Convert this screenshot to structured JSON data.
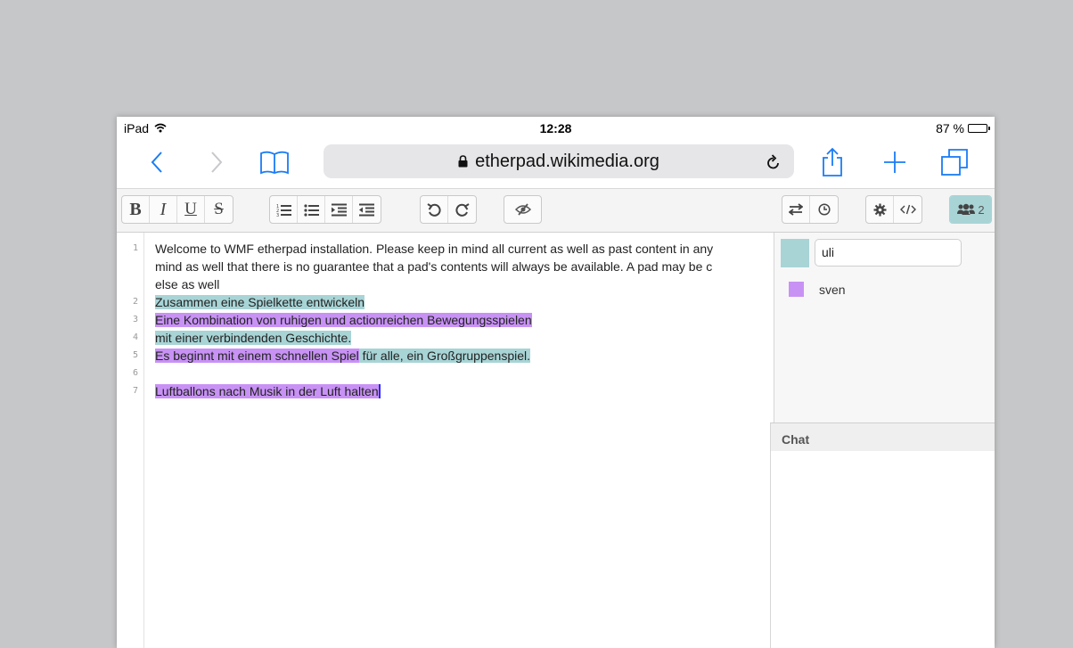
{
  "status": {
    "device": "iPad",
    "time": "12:28",
    "battery": "87 %",
    "battery_level": 0.87
  },
  "browser": {
    "url": "etherpad.wikimedia.org",
    "icons": [
      "back-icon",
      "forward-icon",
      "bookmarks-icon",
      "lock-icon",
      "reload-icon",
      "share-icon",
      "new-tab-icon",
      "tabs-icon"
    ]
  },
  "toolbar": {
    "bold": "B",
    "italic": "I",
    "underline": "U",
    "strike": "S",
    "users_count": "2"
  },
  "editor": {
    "line_numbers": [
      "1",
      "2",
      "3",
      "4",
      "5",
      "6",
      "7"
    ],
    "lines": [
      "Welcome to WMF etherpad installation. Please keep in mind all current as well as past content in any",
      "mind as well that there is no guarantee that a pad's contents will always be available. A pad may be c",
      "else as well",
      "Zusammen eine Spielkette entwickeln",
      "Eine Kombination von ruhigen und actionreichen Bewegungsspielen",
      "mit einer verbindenden Geschichte.",
      "Es beginnt mit einem schnellen Spiel",
      " für alle, ein Großgruppenspiel.",
      "Luftballons nach Musik in der Luft halten"
    ]
  },
  "users": {
    "me": {
      "name": "uli",
      "color": "#a8d4d6"
    },
    "others": [
      {
        "name": "sven",
        "color": "#c892f5"
      }
    ]
  },
  "chat": {
    "title": "Chat"
  }
}
